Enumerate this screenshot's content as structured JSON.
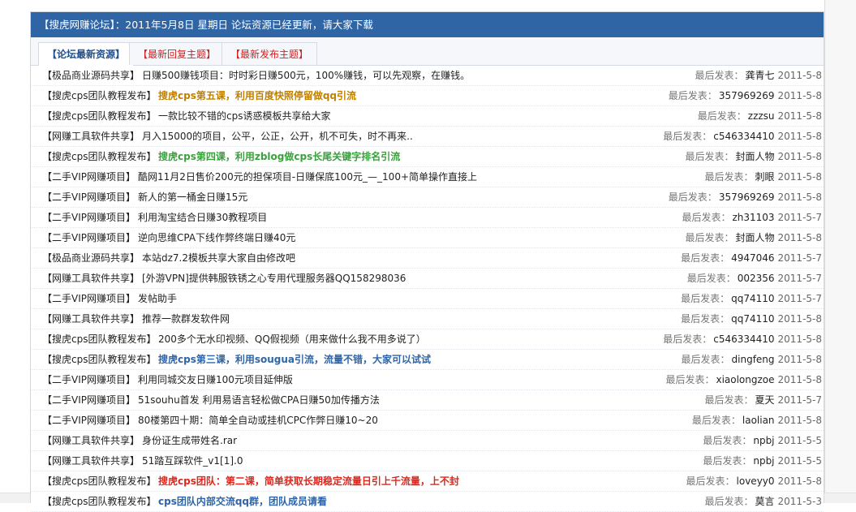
{
  "header": {
    "text": "【搜虎网赚论坛】：2011年5月8日 星期日 论坛资源已经更新，请大家下载"
  },
  "tabs": [
    {
      "label": "【论坛最新资源】"
    },
    {
      "label": "【最新回复主题】"
    },
    {
      "label": "【最新发布主题】"
    }
  ],
  "meta_label": "最后发表：",
  "rows": [
    {
      "category": "【极品商业源码共享】",
      "title": "日赚500赚钱项目：时时彩日赚500元，100%赚钱，可以先观察，在赚钱。",
      "user": "龚青七",
      "date": "2011-5-8"
    },
    {
      "category": "【搜虎cps团队教程发布】",
      "title": "搜虎cps第五课，利用百度快照停留做qq引流",
      "user": "357969269",
      "date": "2011-5-8"
    },
    {
      "category": "【搜虎cps团队教程发布】",
      "title": "一款比较不错的cps诱惑模板共享给大家",
      "user": "zzzsu",
      "date": "2011-5-8"
    },
    {
      "category": "【网赚工具软件共享】",
      "title": "月入15000的项目，公平，公正，公开，机不可失，时不再来..",
      "user": "c546334410",
      "date": "2011-5-8"
    },
    {
      "category": "【搜虎cps团队教程发布】",
      "title": "搜虎cps第四课，利用zblog做cps长尾关键字排名引流",
      "user": "封面人物",
      "date": "2011-5-8"
    },
    {
      "category": "【二手VIP网赚项目】",
      "title": "酷网11月2日售价200元的担保项目-日赚保底100元_—_100+简单操作直接上",
      "user": "刺眼",
      "date": "2011-5-8"
    },
    {
      "category": "【二手VIP网赚项目】",
      "title": "新人的第一桶金日赚15元",
      "user": "357969269",
      "date": "2011-5-8"
    },
    {
      "category": "【二手VIP网赚项目】",
      "title": "利用淘宝结合日赚30教程项目",
      "user": "zh31103",
      "date": "2011-5-7"
    },
    {
      "category": "【二手VIP网赚项目】",
      "title": "逆向思维CPA下线作弊终端日赚40元",
      "user": "封面人物",
      "date": "2011-5-8"
    },
    {
      "category": "【极品商业源码共享】",
      "title": "本站dz7.2模板共享大家自由修改吧",
      "user": "4947046",
      "date": "2011-5-7"
    },
    {
      "category": "【网赚工具软件共享】",
      "title": "[外游VPN]提供韩服铁锈之心专用代理服务器QQ158298036",
      "user": "002356",
      "date": "2011-5-7"
    },
    {
      "category": "【二手VIP网赚项目】",
      "title": "发帖助手",
      "user": "qq74110",
      "date": "2011-5-7"
    },
    {
      "category": "【网赚工具软件共享】",
      "title": "推荐一款群发软件网",
      "user": "qq74110",
      "date": "2011-5-8"
    },
    {
      "category": "【搜虎cps团队教程发布】",
      "title": "200多个无水印视频、QQ假视频（用来做什么我不用多说了）",
      "user": "c546334410",
      "date": "2011-5-8"
    },
    {
      "category": "【搜虎cps团队教程发布】",
      "title": "搜虎cps第三课，利用sougua引流，流量不错，大家可以试试",
      "user": "dingfeng",
      "date": "2011-5-8"
    },
    {
      "category": "【二手VIP网赚项目】",
      "title": "利用同城交友日赚100元项目延伸版",
      "user": "xiaolongzoe",
      "date": "2011-5-8"
    },
    {
      "category": "【二手VIP网赚项目】",
      "title": "51souhu首发 利用易语言轻松做CPA日赚50加传播方法",
      "user": "夏天",
      "date": "2011-5-7"
    },
    {
      "category": "【二手VIP网赚项目】",
      "title": "80楼第四十期：简单全自动或挂机CPC作弊日赚10~20",
      "user": "laolian",
      "date": "2011-5-8"
    },
    {
      "category": "【网赚工具软件共享】",
      "title": "身份证生成带姓名.rar",
      "user": "npbj",
      "date": "2011-5-5"
    },
    {
      "category": "【网赚工具软件共享】",
      "title": "51踏互踩软件_v1[1].0",
      "user": "npbj",
      "date": "2011-5-5"
    },
    {
      "category": "【搜虎cps团队教程发布】",
      "title": "搜虎cps团队：第二课，简单获取长期稳定流量日引上千流量，上不封",
      "user": "loveyy0",
      "date": "2011-5-8"
    },
    {
      "category": "【搜虎cps团队教程发布】",
      "title": "cps团队内部交流qq群，团队成员请看",
      "user": "莫言",
      "date": "2011-5-3"
    }
  ],
  "colors": {
    "header_bg": "#2f64a5",
    "tab_active": "#1f4f8c",
    "tab_red": "#d42020",
    "hl_gold": "#c08000",
    "hl_green": "#39a23c",
    "hl_blue": "#2e65a8",
    "hl_red": "#e0261c"
  }
}
